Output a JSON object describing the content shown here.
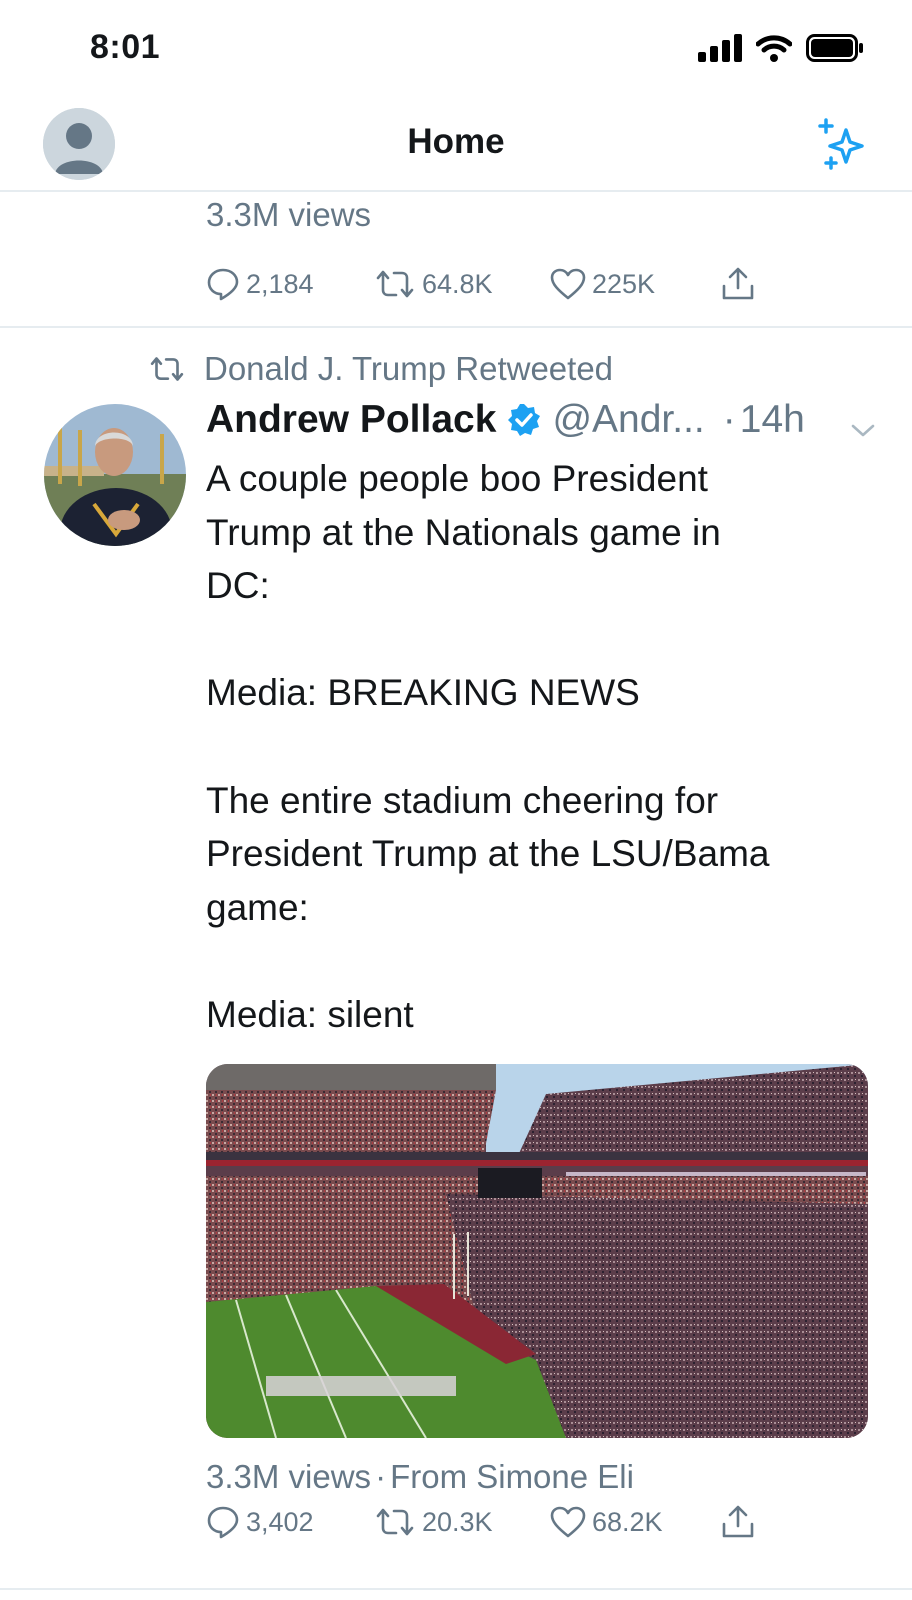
{
  "status_bar": {
    "time": "8:01",
    "icons": [
      "cellular-signal-icon",
      "wifi-icon",
      "battery-icon"
    ]
  },
  "nav": {
    "title": "Home",
    "left_icon": "profile-avatar",
    "right_icon": "sparkle-icon",
    "accent": "#1da1f2"
  },
  "previous_tweet": {
    "views": "3.3M views",
    "replies": "2,184",
    "retweets": "64.8K",
    "likes": "225K"
  },
  "tweet": {
    "retweeted_by": "Donald J. Trump Retweeted",
    "author_name": "Andrew Pollack",
    "verified": true,
    "handle": "@Andr...",
    "time": "14h",
    "text_lines": [
      "A couple people boo President",
      "Trump at the Nationals game in",
      "DC:",
      "",
      "Media: BREAKING NEWS",
      "",
      "The entire stadium cheering for",
      "President Trump at the LSU/Bama",
      "game:",
      "",
      "Media: silent"
    ],
    "media": "stadium video thumbnail",
    "views": "3.3M views",
    "source_sep": "·",
    "source": "From Simone Eli",
    "replies": "3,402",
    "retweets": "20.3K",
    "likes": "68.2K"
  }
}
